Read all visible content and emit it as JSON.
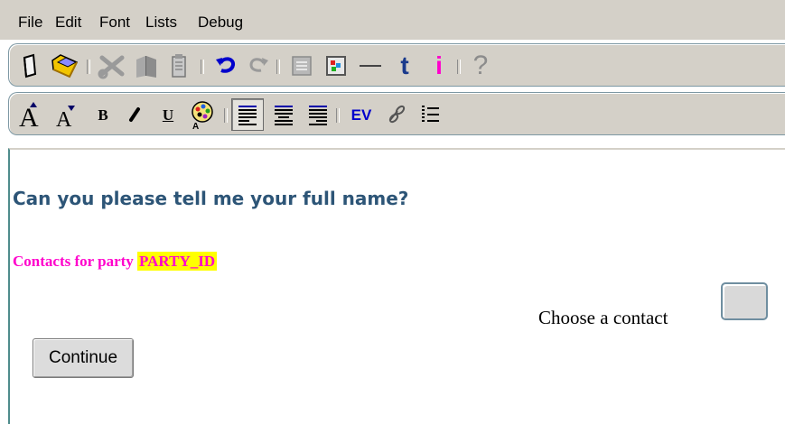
{
  "menu": [
    "File",
    "Edit",
    "Font",
    "Lists",
    "Debug"
  ],
  "toolbar1": {
    "icons": [
      "new-document-icon",
      "open-folder-icon",
      "cut-icon",
      "copy-icon",
      "paste-icon",
      "undo-icon",
      "redo-icon",
      "form-icon",
      "image-icon",
      "horizontal-rule-icon",
      "text-t-icon",
      "info-i-icon",
      "help-question-icon"
    ],
    "t_label": "t",
    "i_label": "i",
    "help_label": "?"
  },
  "toolbar2": {
    "icons": [
      "font-size-increase-icon",
      "font-size-decrease-icon",
      "bold-icon",
      "italic-icon",
      "underline-icon",
      "color-palette-icon",
      "align-left-icon",
      "align-center-icon",
      "align-right-icon",
      "ev-icon",
      "link-icon",
      "numbered-list-icon"
    ],
    "bold_label": "B",
    "italic_label": "I",
    "underline_label": "U",
    "ev_label": "EV"
  },
  "content": {
    "question": "Can you please tell me your full name?",
    "contacts_prefix": "Contacts for party ",
    "party_id": "PARTY_ID",
    "choose_label": "Choose a contact",
    "continue_label": "Continue"
  },
  "colors": {
    "question": "#2d5577",
    "magenta": "#ff00cc",
    "highlight": "#ffff00",
    "toolbar_bg": "#d4d0c8",
    "accent_blue": "#0000cc"
  }
}
